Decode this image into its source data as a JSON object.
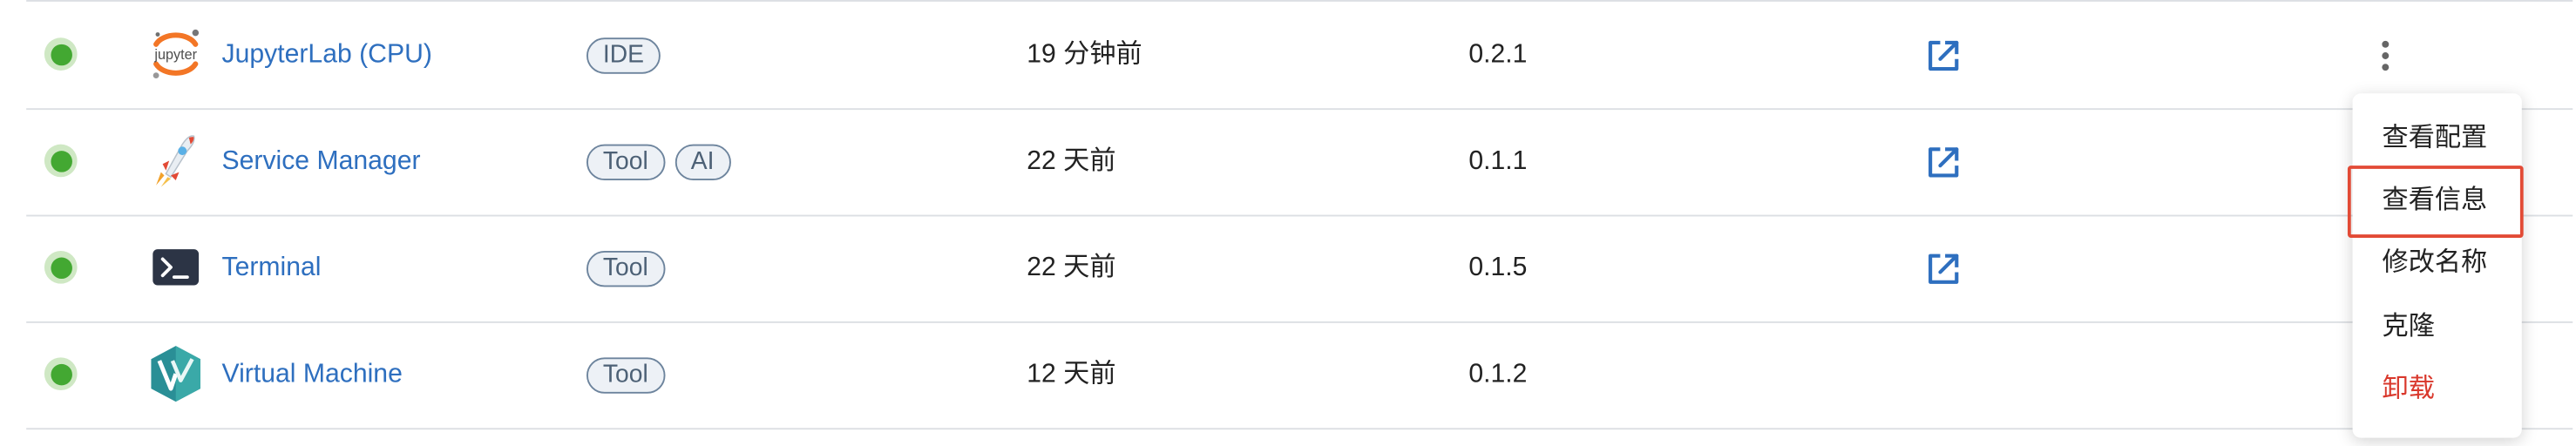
{
  "apps": [
    {
      "name": "JupyterLab (CPU)",
      "icon": "jupyter-logo-icon",
      "icon_text": "jupyter",
      "tags": [
        "IDE"
      ],
      "updated": "19 分钟前",
      "version": "0.2.1",
      "has_open_link": true,
      "status": "running"
    },
    {
      "name": "Service Manager",
      "icon": "rocket-icon",
      "tags": [
        "Tool",
        "AI"
      ],
      "updated": "22 天前",
      "version": "0.1.1",
      "has_open_link": true,
      "status": "running"
    },
    {
      "name": "Terminal",
      "icon": "terminal-icon",
      "tags": [
        "Tool"
      ],
      "updated": "22 天前",
      "version": "0.1.5",
      "has_open_link": true,
      "status": "running"
    },
    {
      "name": "Virtual Machine",
      "icon": "virtual-machine-logo-icon",
      "tags": [
        "Tool"
      ],
      "updated": "12 天前",
      "version": "0.1.2",
      "has_open_link": false,
      "status": "running"
    }
  ],
  "context_menu": {
    "items": [
      "查看配置",
      "查看信息",
      "修改名称",
      "克隆",
      "卸载"
    ],
    "highlighted_index": 1,
    "danger_index": 4
  },
  "colors": {
    "link": "#2e6fbf",
    "status_running": "#43a832",
    "danger": "#d9382c",
    "highlight_border": "#e24a35"
  }
}
